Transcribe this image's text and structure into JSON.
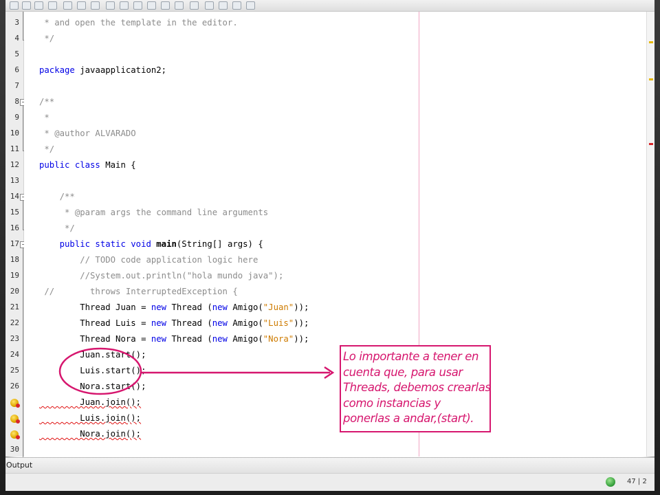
{
  "editor": {
    "lines": [
      {
        "number": "3",
        "segments": [
          {
            "cls": "cm",
            "text": " * and open the template in the editor."
          }
        ]
      },
      {
        "number": "4",
        "segments": [
          {
            "cls": "cm",
            "text": " */"
          }
        ]
      },
      {
        "number": "5",
        "segments": []
      },
      {
        "number": "6",
        "segments": [
          {
            "cls": "kw",
            "text": "package"
          },
          {
            "cls": "",
            "text": " javaapplication2;"
          }
        ]
      },
      {
        "number": "7",
        "segments": []
      },
      {
        "number": "8",
        "segments": [
          {
            "cls": "cm",
            "text": "/**"
          }
        ]
      },
      {
        "number": "9",
        "segments": [
          {
            "cls": "cm",
            "text": " *"
          }
        ]
      },
      {
        "number": "10",
        "segments": [
          {
            "cls": "cm",
            "text": " * @author ALVARADO"
          }
        ]
      },
      {
        "number": "11",
        "segments": [
          {
            "cls": "cm",
            "text": " */"
          }
        ]
      },
      {
        "number": "12",
        "segments": [
          {
            "cls": "kw",
            "text": "public class"
          },
          {
            "cls": "",
            "text": " Main {"
          }
        ]
      },
      {
        "number": "13",
        "segments": []
      },
      {
        "number": "14",
        "segments": [
          {
            "cls": "cm",
            "text": "    /**"
          }
        ]
      },
      {
        "number": "15",
        "segments": [
          {
            "cls": "cm",
            "text": "     * @param args the command line arguments"
          }
        ]
      },
      {
        "number": "16",
        "segments": [
          {
            "cls": "cm",
            "text": "     */"
          }
        ]
      },
      {
        "number": "17",
        "segments": [
          {
            "cls": "kw",
            "text": "    public static void"
          },
          {
            "cls": "b",
            "text": " main"
          },
          {
            "cls": "",
            "text": "(String[] args) {"
          }
        ]
      },
      {
        "number": "18",
        "segments": [
          {
            "cls": "cm",
            "text": "        // TODO code application logic here"
          }
        ]
      },
      {
        "number": "19",
        "segments": [
          {
            "cls": "cm",
            "text": "        //System.out.println(\"hola mundo java\");"
          }
        ]
      },
      {
        "number": "20",
        "segments": [
          {
            "cls": "cm",
            "text": " //       throws InterruptedException {"
          }
        ]
      },
      {
        "number": "21",
        "segments": [
          {
            "cls": "",
            "text": "        Thread Juan = "
          },
          {
            "cls": "kw",
            "text": "new"
          },
          {
            "cls": "",
            "text": " Thread ("
          },
          {
            "cls": "kw",
            "text": "new"
          },
          {
            "cls": "",
            "text": " Amigo("
          },
          {
            "cls": "str",
            "text": "\"Juan\""
          },
          {
            "cls": "",
            "text": "));"
          }
        ]
      },
      {
        "number": "22",
        "segments": [
          {
            "cls": "",
            "text": "        Thread Luis = "
          },
          {
            "cls": "kw",
            "text": "new"
          },
          {
            "cls": "",
            "text": " Thread ("
          },
          {
            "cls": "kw",
            "text": "new"
          },
          {
            "cls": "",
            "text": " Amigo("
          },
          {
            "cls": "str",
            "text": "\"Luis\""
          },
          {
            "cls": "",
            "text": "));"
          }
        ]
      },
      {
        "number": "23",
        "segments": [
          {
            "cls": "",
            "text": "        Thread Nora = "
          },
          {
            "cls": "kw",
            "text": "new"
          },
          {
            "cls": "",
            "text": " Thread ("
          },
          {
            "cls": "kw",
            "text": "new"
          },
          {
            "cls": "",
            "text": " Amigo("
          },
          {
            "cls": "str",
            "text": "\"Nora\""
          },
          {
            "cls": "",
            "text": "));"
          }
        ]
      },
      {
        "number": "24",
        "segments": [
          {
            "cls": "",
            "text": "        Juan.start();"
          }
        ]
      },
      {
        "number": "25",
        "segments": [
          {
            "cls": "",
            "text": "        Luis.start();"
          }
        ]
      },
      {
        "number": "26",
        "segments": [
          {
            "cls": "",
            "text": "        Nora.start();"
          }
        ]
      },
      {
        "number": "",
        "segments": [
          {
            "cls": "err",
            "text": "        Juan.join();"
          }
        ]
      },
      {
        "number": "",
        "segments": [
          {
            "cls": "err",
            "text": "        Luis.join();"
          }
        ]
      },
      {
        "number": "",
        "segments": [
          {
            "cls": "err",
            "text": "        Nora.join();"
          }
        ]
      },
      {
        "number": "30",
        "segments": []
      }
    ]
  },
  "statusbar": {
    "output_label": "Output",
    "position": "47 | 2"
  },
  "callout": {
    "lines": [
      "Lo importante a tener en",
      "cuenta que, para usar",
      "Threads, debemos crearlas",
      "como instancias y",
      "ponerlas a andar,(start)."
    ],
    "color": "#d6166e"
  },
  "colors": {
    "keyword": "#0000e6",
    "comment": "#8c8c8c",
    "string": "#ce7b00",
    "annotation": "#d6166e"
  },
  "icons": [
    "warning-error-icon",
    "fold-icon",
    "globe-icon"
  ]
}
